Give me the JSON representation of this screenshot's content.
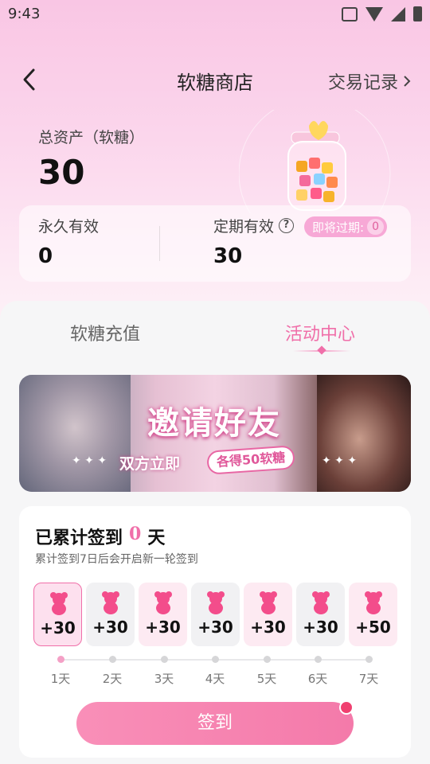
{
  "status_bar": {
    "time": "9:43"
  },
  "header": {
    "title": "软糖商店",
    "history_label": "交易记录"
  },
  "assets": {
    "label": "总资产（软糖）",
    "value": "30"
  },
  "validity": {
    "permanent_label": "永久有效",
    "permanent_value": "0",
    "timed_label": "定期有效",
    "timed_value": "30",
    "expire_label": "即将过期:",
    "expire_count": "0"
  },
  "tabs": [
    {
      "label": "软糖充值",
      "active": false
    },
    {
      "label": "活动中心",
      "active": true
    }
  ],
  "banner": {
    "title": "邀请好友",
    "subtitle": "双方立即",
    "pill": "各得50软糖"
  },
  "checkin": {
    "title_prefix": "已累计签到",
    "count": "0",
    "title_suffix": "天",
    "description": "累计签到7日后会开启新一轮签到",
    "days": [
      {
        "reward": "+30",
        "label": "1天",
        "style": "active"
      },
      {
        "reward": "+30",
        "label": "2天",
        "style": "plain"
      },
      {
        "reward": "+30",
        "label": "3天",
        "style": "pink"
      },
      {
        "reward": "+30",
        "label": "4天",
        "style": "plain"
      },
      {
        "reward": "+30",
        "label": "5天",
        "style": "pink"
      },
      {
        "reward": "+30",
        "label": "6天",
        "style": "plain"
      },
      {
        "reward": "+50",
        "label": "7天",
        "style": "pink"
      }
    ],
    "button_label": "签到"
  },
  "colors": {
    "accent": "#f06fa9",
    "button": "#f47aaa",
    "badge": "#f7a8d6"
  }
}
